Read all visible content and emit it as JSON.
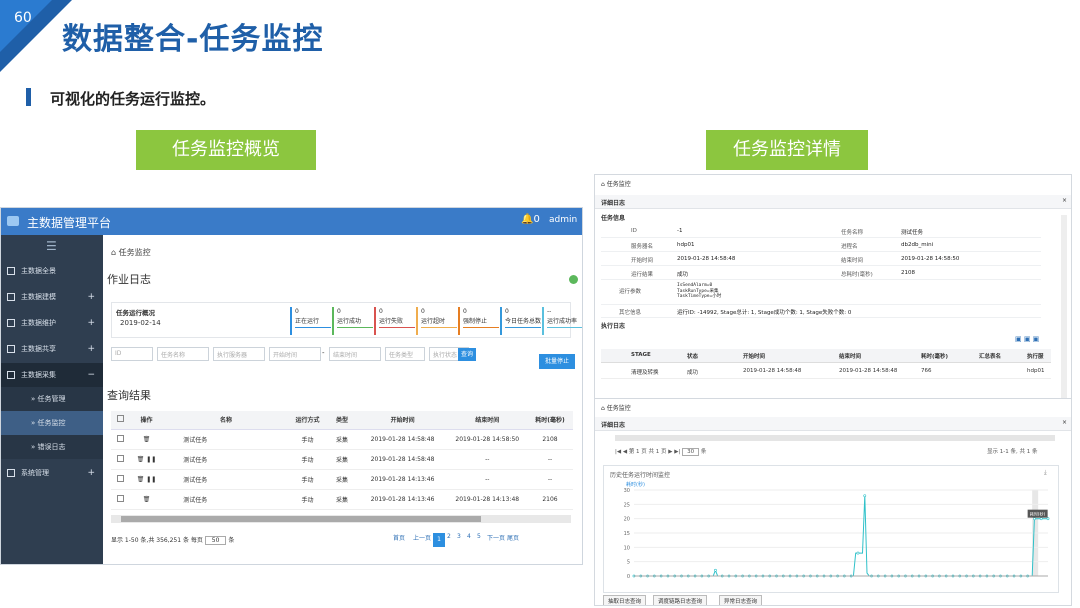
{
  "slide": {
    "page_number": "60",
    "title": "数据整合-任务监控",
    "subtitle": "可视化的任务运行监控。",
    "label_overview": "任务监控概览",
    "label_detail": "任务监控详情",
    "colors": {
      "brand": "#1f5fa8",
      "label_green": "#8cc63f"
    }
  },
  "left": {
    "app_title": "主数据管理平台",
    "bell_count": "0",
    "user": "admin",
    "sidebar": [
      "主数据全景",
      "主数据建模",
      "主数据维护",
      "主数据共享",
      "主数据采集",
      "任务管理",
      "任务监控",
      "错误日志",
      "系统管理"
    ],
    "breadcrumb": "任务监控",
    "section_title": "作业日志",
    "overview_label": "任务运行概况",
    "overview_date": "2019-02-14",
    "stats": [
      {
        "value": "0",
        "label": "正在运行",
        "color": "#2d8fe0"
      },
      {
        "value": "0",
        "label": "运行成功",
        "color": "#5cb85c"
      },
      {
        "value": "0",
        "label": "运行失败",
        "color": "#d9534f"
      },
      {
        "value": "0",
        "label": "运行超时",
        "color": "#f0ad4e"
      },
      {
        "value": "0",
        "label": "强制停止",
        "color": "#e67e22"
      },
      {
        "value": "0",
        "label": "今日任务总数",
        "color": "#3498db"
      },
      {
        "value": "--",
        "label": "运行成功率",
        "color": "#5bc0de"
      }
    ],
    "filters": [
      "ID",
      "任务名称",
      "执行服务器",
      "开始时间",
      "结束时间",
      "任务类型",
      "执行状态"
    ],
    "filter_sep": "-",
    "search_btn": "查询",
    "batch_stop_btn": "批量停止",
    "results_title": "查询结果",
    "columns": [
      "操作",
      "名称",
      "运行方式",
      "类型",
      "开始时间",
      "结束时间",
      "耗时(毫秒)"
    ],
    "rows": [
      {
        "name": "测试任务",
        "mode": "手动",
        "type": "采集",
        "start": "2019-01-28 14:58:48",
        "end": "2019-01-28 14:58:50",
        "cost": "2108"
      },
      {
        "name": "测试任务",
        "mode": "手动",
        "type": "采集",
        "start": "2019-01-28 14:58:48",
        "end": "--",
        "cost": "--"
      },
      {
        "name": "测试任务",
        "mode": "手动",
        "type": "采集",
        "start": "2019-01-28 14:13:46",
        "end": "--",
        "cost": "--"
      },
      {
        "name": "测试任务",
        "mode": "手动",
        "type": "采集",
        "start": "2019-01-28 14:13:46",
        "end": "2019-01-28 14:13:48",
        "cost": "2106"
      }
    ],
    "pagination_info": "显示 1-50 条,共 356,251 条 每页",
    "page_size": "50",
    "page_size_unit": "条",
    "pager": [
      "首页",
      "上一页",
      "1",
      "2",
      "3",
      "4",
      "5",
      "下一页",
      "尾页"
    ]
  },
  "right1": {
    "crumb": "任务监控",
    "panel_title": "详细日志",
    "info_title": "任务信息",
    "fields": [
      [
        "ID",
        "-1",
        "任务名称",
        "测试任务"
      ],
      [
        "服务器名",
        "hdp01",
        "进程名",
        "db2db_mini"
      ],
      [
        "开始时间",
        "2019-01-28 14:58:48",
        "结束时间",
        "2019-01-28 14:58:50"
      ],
      [
        "运行结果",
        "成功",
        "总耗时(毫秒)",
        "2108"
      ]
    ],
    "param_key": "运行参数",
    "params": [
      "IsSendAlarm=0",
      "TaskRunType=采集",
      "TaskTimeType=小时"
    ],
    "other_key": "其它信息",
    "other_val": "运行ID: -14992, Stage总计: 1, Stage成功个数: 1, Stage失败个数: 0",
    "log_title": "执行日志",
    "log_cols": [
      "STAGE",
      "状态",
      "开始时间",
      "结束时间",
      "耗时(毫秒)",
      "汇总表名",
      "执行服"
    ],
    "log_row": [
      "清理及转换",
      "成功",
      "2019-01-28 14:58:48",
      "2019-01-28 14:58:48",
      "766",
      "",
      "hdp01"
    ]
  },
  "right2": {
    "crumb": "任务监控",
    "panel_title": "详细日志",
    "pager_text": "第 1 页 共 1 页",
    "page_size": "30",
    "page_size_unit": "条",
    "pager_right": "显示 1-1 条, 共 1 条",
    "chart_title": "历史任务运行时间监控",
    "tooltip": "耗时(秒)",
    "tabs": [
      "抽取日志查询",
      "调度链路日志查询",
      "异常日志查询"
    ]
  },
  "chart_data": {
    "type": "line",
    "title": "历史任务运行时间监控",
    "ylabel": "耗时(秒)",
    "ylim": [
      0,
      30
    ],
    "yticks": [
      0,
      5,
      10,
      15,
      20,
      25,
      30
    ],
    "values": [
      0,
      0,
      0,
      0,
      0,
      0,
      0,
      0,
      0,
      0,
      0,
      0,
      0,
      0,
      0,
      0,
      0,
      0,
      0,
      0,
      0,
      0,
      0,
      0,
      0,
      0,
      0,
      0,
      0,
      0,
      0,
      0,
      0,
      0,
      0,
      0,
      2,
      0,
      0,
      0,
      0,
      0,
      0,
      0,
      0,
      0,
      0,
      0,
      0,
      0,
      0,
      0,
      0,
      0,
      0,
      0,
      0,
      0,
      0,
      0,
      0,
      0,
      0,
      0,
      0,
      0,
      0,
      0,
      0,
      0,
      0,
      0,
      0,
      0,
      0,
      0,
      0,
      0,
      0,
      0,
      0,
      0,
      0,
      0,
      0,
      0,
      0,
      0,
      0,
      0,
      0,
      0,
      0,
      0,
      0,
      0,
      0,
      0,
      8,
      8,
      8,
      8,
      28,
      1,
      0,
      0,
      0,
      0,
      0,
      0,
      0,
      0,
      0,
      0,
      0,
      0,
      0,
      0,
      0,
      0,
      0,
      0,
      0,
      0,
      0,
      0,
      0,
      0,
      0,
      0,
      0,
      0,
      0,
      0,
      0,
      0,
      0,
      0,
      0,
      0,
      0,
      0,
      0,
      0,
      0,
      0,
      0,
      0,
      0,
      0,
      0,
      0,
      0,
      0,
      0,
      0,
      0,
      0,
      0,
      0,
      0,
      0,
      0,
      0,
      0,
      0,
      0,
      0,
      0,
      0,
      0,
      0,
      0,
      0,
      0,
      0,
      0,
      20,
      20,
      20,
      20,
      20,
      20,
      20
    ]
  }
}
